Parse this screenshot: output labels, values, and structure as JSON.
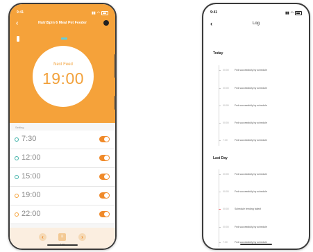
{
  "left_phone": {
    "status": {
      "time": "9:41"
    },
    "header": {
      "title": "NutriSpin 6 Meal Pet Feeder"
    },
    "next_feed": {
      "label": "Next Feed",
      "time": "19:00"
    },
    "schedule": {
      "header": "Setting",
      "items": [
        {
          "time": "7:30",
          "enabled": true
        },
        {
          "time": "12:00",
          "enabled": true
        },
        {
          "time": "15:00",
          "enabled": true
        },
        {
          "time": "19:00",
          "enabled": true
        },
        {
          "time": "22:00",
          "enabled": true
        }
      ]
    },
    "nav": {
      "log_label": "Log"
    }
  },
  "right_phone": {
    "status": {
      "time": "9:41"
    },
    "header": {
      "title": "Log"
    },
    "sections": [
      {
        "title": "Today",
        "entries": [
          {
            "time": "00:00",
            "message": "Fed successfully by schedule"
          },
          {
            "time": "00:00",
            "message": "Fed successfully by schedule"
          },
          {
            "time": "00:00",
            "message": "Fed successfully by schedule"
          },
          {
            "time": "00:00",
            "message": "Fed successfully by schedule"
          },
          {
            "time": "7:30",
            "message": "Fed successfully by schedule"
          }
        ]
      },
      {
        "title": "Last Day",
        "entries": [
          {
            "time": "00:00",
            "message": "Fed successfully by schedule"
          },
          {
            "time": "00:00",
            "message": "Fed successfully by schedule"
          },
          {
            "time": "00:00",
            "message": "Schedule feeding failed!"
          },
          {
            "time": "00:00",
            "message": "Fed successfully by schedule"
          },
          {
            "time": "7:00",
            "message": "Fed successfully by schedule"
          }
        ]
      }
    ]
  },
  "colors": {
    "accent": "#f5a23a",
    "toggle_on": "#f08a2a",
    "ok": "#3fb2a8",
    "error": "#f07a7a"
  }
}
